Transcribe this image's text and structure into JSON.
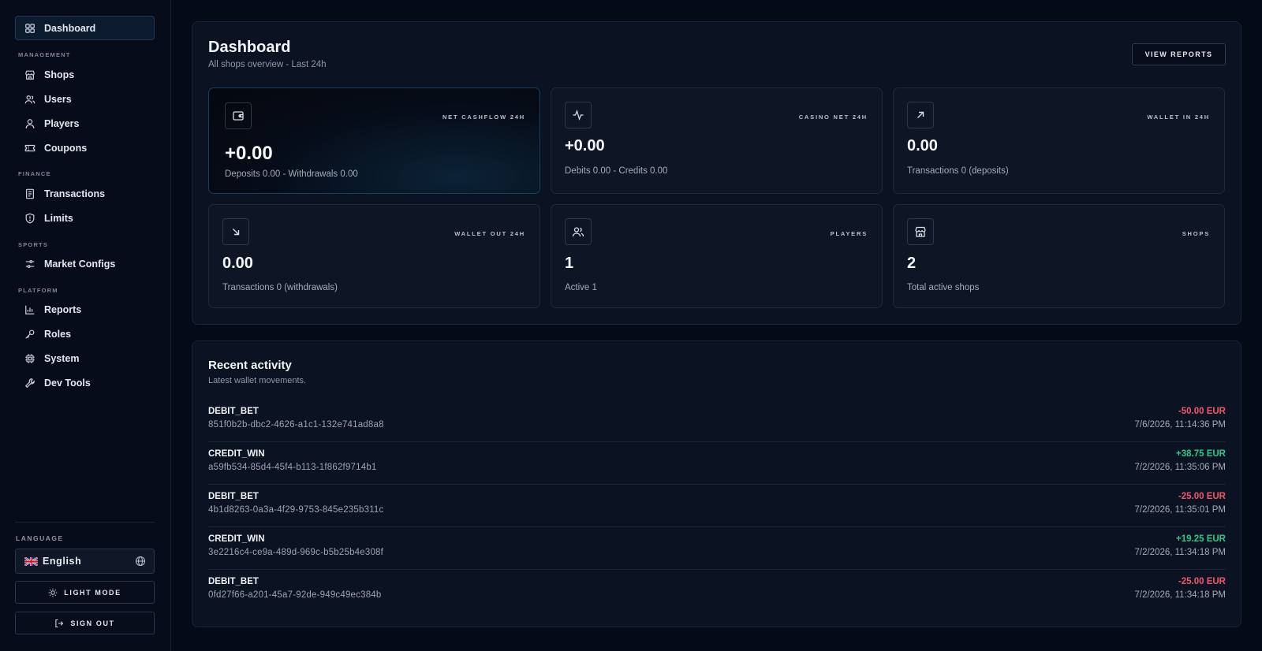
{
  "sidebar": {
    "dashboard": "Dashboard",
    "sections": {
      "management": "MANAGEMENT",
      "finance": "FINANCE",
      "sports": "SPORTS",
      "platform": "PLATFORM"
    },
    "items": {
      "shops": "Shops",
      "users": "Users",
      "players": "Players",
      "coupons": "Coupons",
      "transactions": "Transactions",
      "limits": "Limits",
      "market_configs": "Market Configs",
      "reports": "Reports",
      "roles": "Roles",
      "system": "System",
      "dev_tools": "Dev Tools"
    },
    "language_label": "LANGUAGE",
    "language_value": "English",
    "light_mode": "LIGHT MODE",
    "sign_out": "SIGN OUT"
  },
  "header": {
    "title": "Dashboard",
    "subtitle": "All shops overview - Last 24h",
    "view_reports": "VIEW REPORTS"
  },
  "cards": {
    "net_cashflow": {
      "label": "NET CASHFLOW 24H",
      "value": "+0.00",
      "sub": "Deposits 0.00 - Withdrawals 0.00",
      "icon": "wallet-icon"
    },
    "casino_net": {
      "label": "CASINO NET 24H",
      "value": "+0.00",
      "sub": "Debits 0.00 - Credits 0.00",
      "icon": "activity-icon"
    },
    "wallet_in": {
      "label": "WALLET IN 24H",
      "value": "0.00",
      "sub": "Transactions 0 (deposits)",
      "icon": "arrow-up-right-icon"
    },
    "wallet_out": {
      "label": "WALLET OUT 24H",
      "value": "0.00",
      "sub": "Transactions 0 (withdrawals)",
      "icon": "arrow-down-right-icon"
    },
    "players": {
      "label": "PLAYERS",
      "value": "1",
      "sub": "Active 1",
      "icon": "users-icon"
    },
    "shops": {
      "label": "SHOPS",
      "value": "2",
      "sub": "Total active shops",
      "icon": "store-icon"
    }
  },
  "activity": {
    "title": "Recent activity",
    "subtitle": "Latest wallet movements.",
    "rows": [
      {
        "type": "DEBIT_BET",
        "id": "851f0b2b-dbc2-4626-a1c1-132e741ad8a8",
        "amount": "-50.00 EUR",
        "time": "7/6/2026, 11:14:36 PM"
      },
      {
        "type": "CREDIT_WIN",
        "id": "a59fb534-85d4-45f4-b113-1f862f9714b1",
        "amount": "+38.75 EUR",
        "time": "7/2/2026, 11:35:06 PM"
      },
      {
        "type": "DEBIT_BET",
        "id": "4b1d8263-0a3a-4f29-9753-845e235b311c",
        "amount": "-25.00 EUR",
        "time": "7/2/2026, 11:35:01 PM"
      },
      {
        "type": "CREDIT_WIN",
        "id": "3e2216c4-ce9a-489d-969c-b5b25b4e308f",
        "amount": "+19.25 EUR",
        "time": "7/2/2026, 11:34:18 PM"
      },
      {
        "type": "DEBIT_BET",
        "id": "0fd27f66-a201-45a7-92de-949c49ec384b",
        "amount": "-25.00 EUR",
        "time": "7/2/2026, 11:34:18 PM"
      }
    ]
  },
  "colors": {
    "background": "#050a17",
    "panel": "#0b1221",
    "negative": "#f0566b",
    "positive": "#2ec98a",
    "accent_border": "#16405e"
  }
}
